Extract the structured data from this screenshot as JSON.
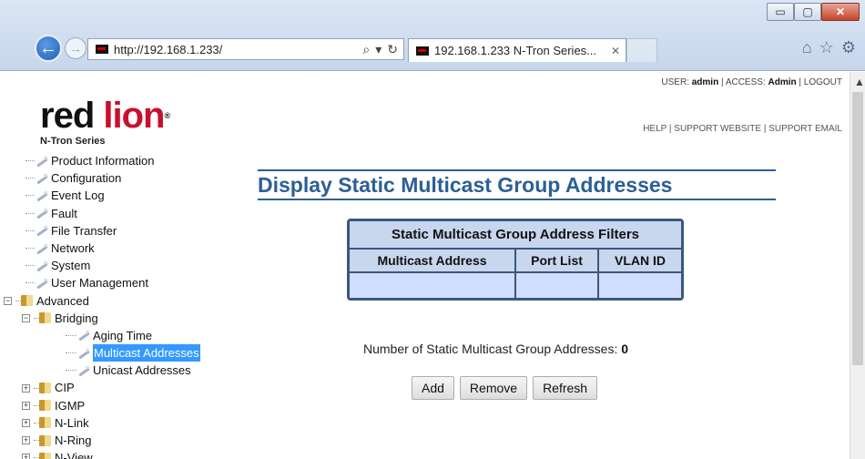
{
  "browser": {
    "url": "http://192.168.1.233/",
    "tab_title": "192.168.1.233 N-Tron Series...",
    "win_min": "▭",
    "win_max": "▢",
    "win_close": "✕"
  },
  "header": {
    "logo_red": "red",
    "logo_lion": "lion",
    "logo_sub": "N-Tron Series",
    "user_label": "USER:",
    "user": "admin",
    "access_label": "ACCESS:",
    "access": "Admin",
    "logout": "LOGOUT",
    "help": "HELP",
    "support_website": "SUPPORT WEBSITE",
    "support_email": "SUPPORT EMAIL"
  },
  "tree": {
    "product_information": "Product Information",
    "configuration": "Configuration",
    "event_log": "Event Log",
    "fault": "Fault",
    "file_transfer": "File Transfer",
    "network": "Network",
    "system": "System",
    "user_management": "User Management",
    "advanced": "Advanced",
    "bridging": "Bridging",
    "aging_time": "Aging Time",
    "multicast_addresses": "Multicast Addresses",
    "unicast_addresses": "Unicast Addresses",
    "cip": "CIP",
    "igmp": "IGMP",
    "n_link": "N-Link",
    "n_ring": "N-Ring",
    "n_view": "N-View"
  },
  "main": {
    "title": "Display Static Multicast Group Addresses",
    "table_caption": "Static Multicast Group Address Filters",
    "col_multicast": "Multicast Address",
    "col_port_list": "Port List",
    "col_vlan_id": "VLAN ID",
    "count_label": "Number of Static Multicast Group Addresses:",
    "count_value": "0",
    "add": "Add",
    "remove": "Remove",
    "refresh": "Refresh"
  }
}
